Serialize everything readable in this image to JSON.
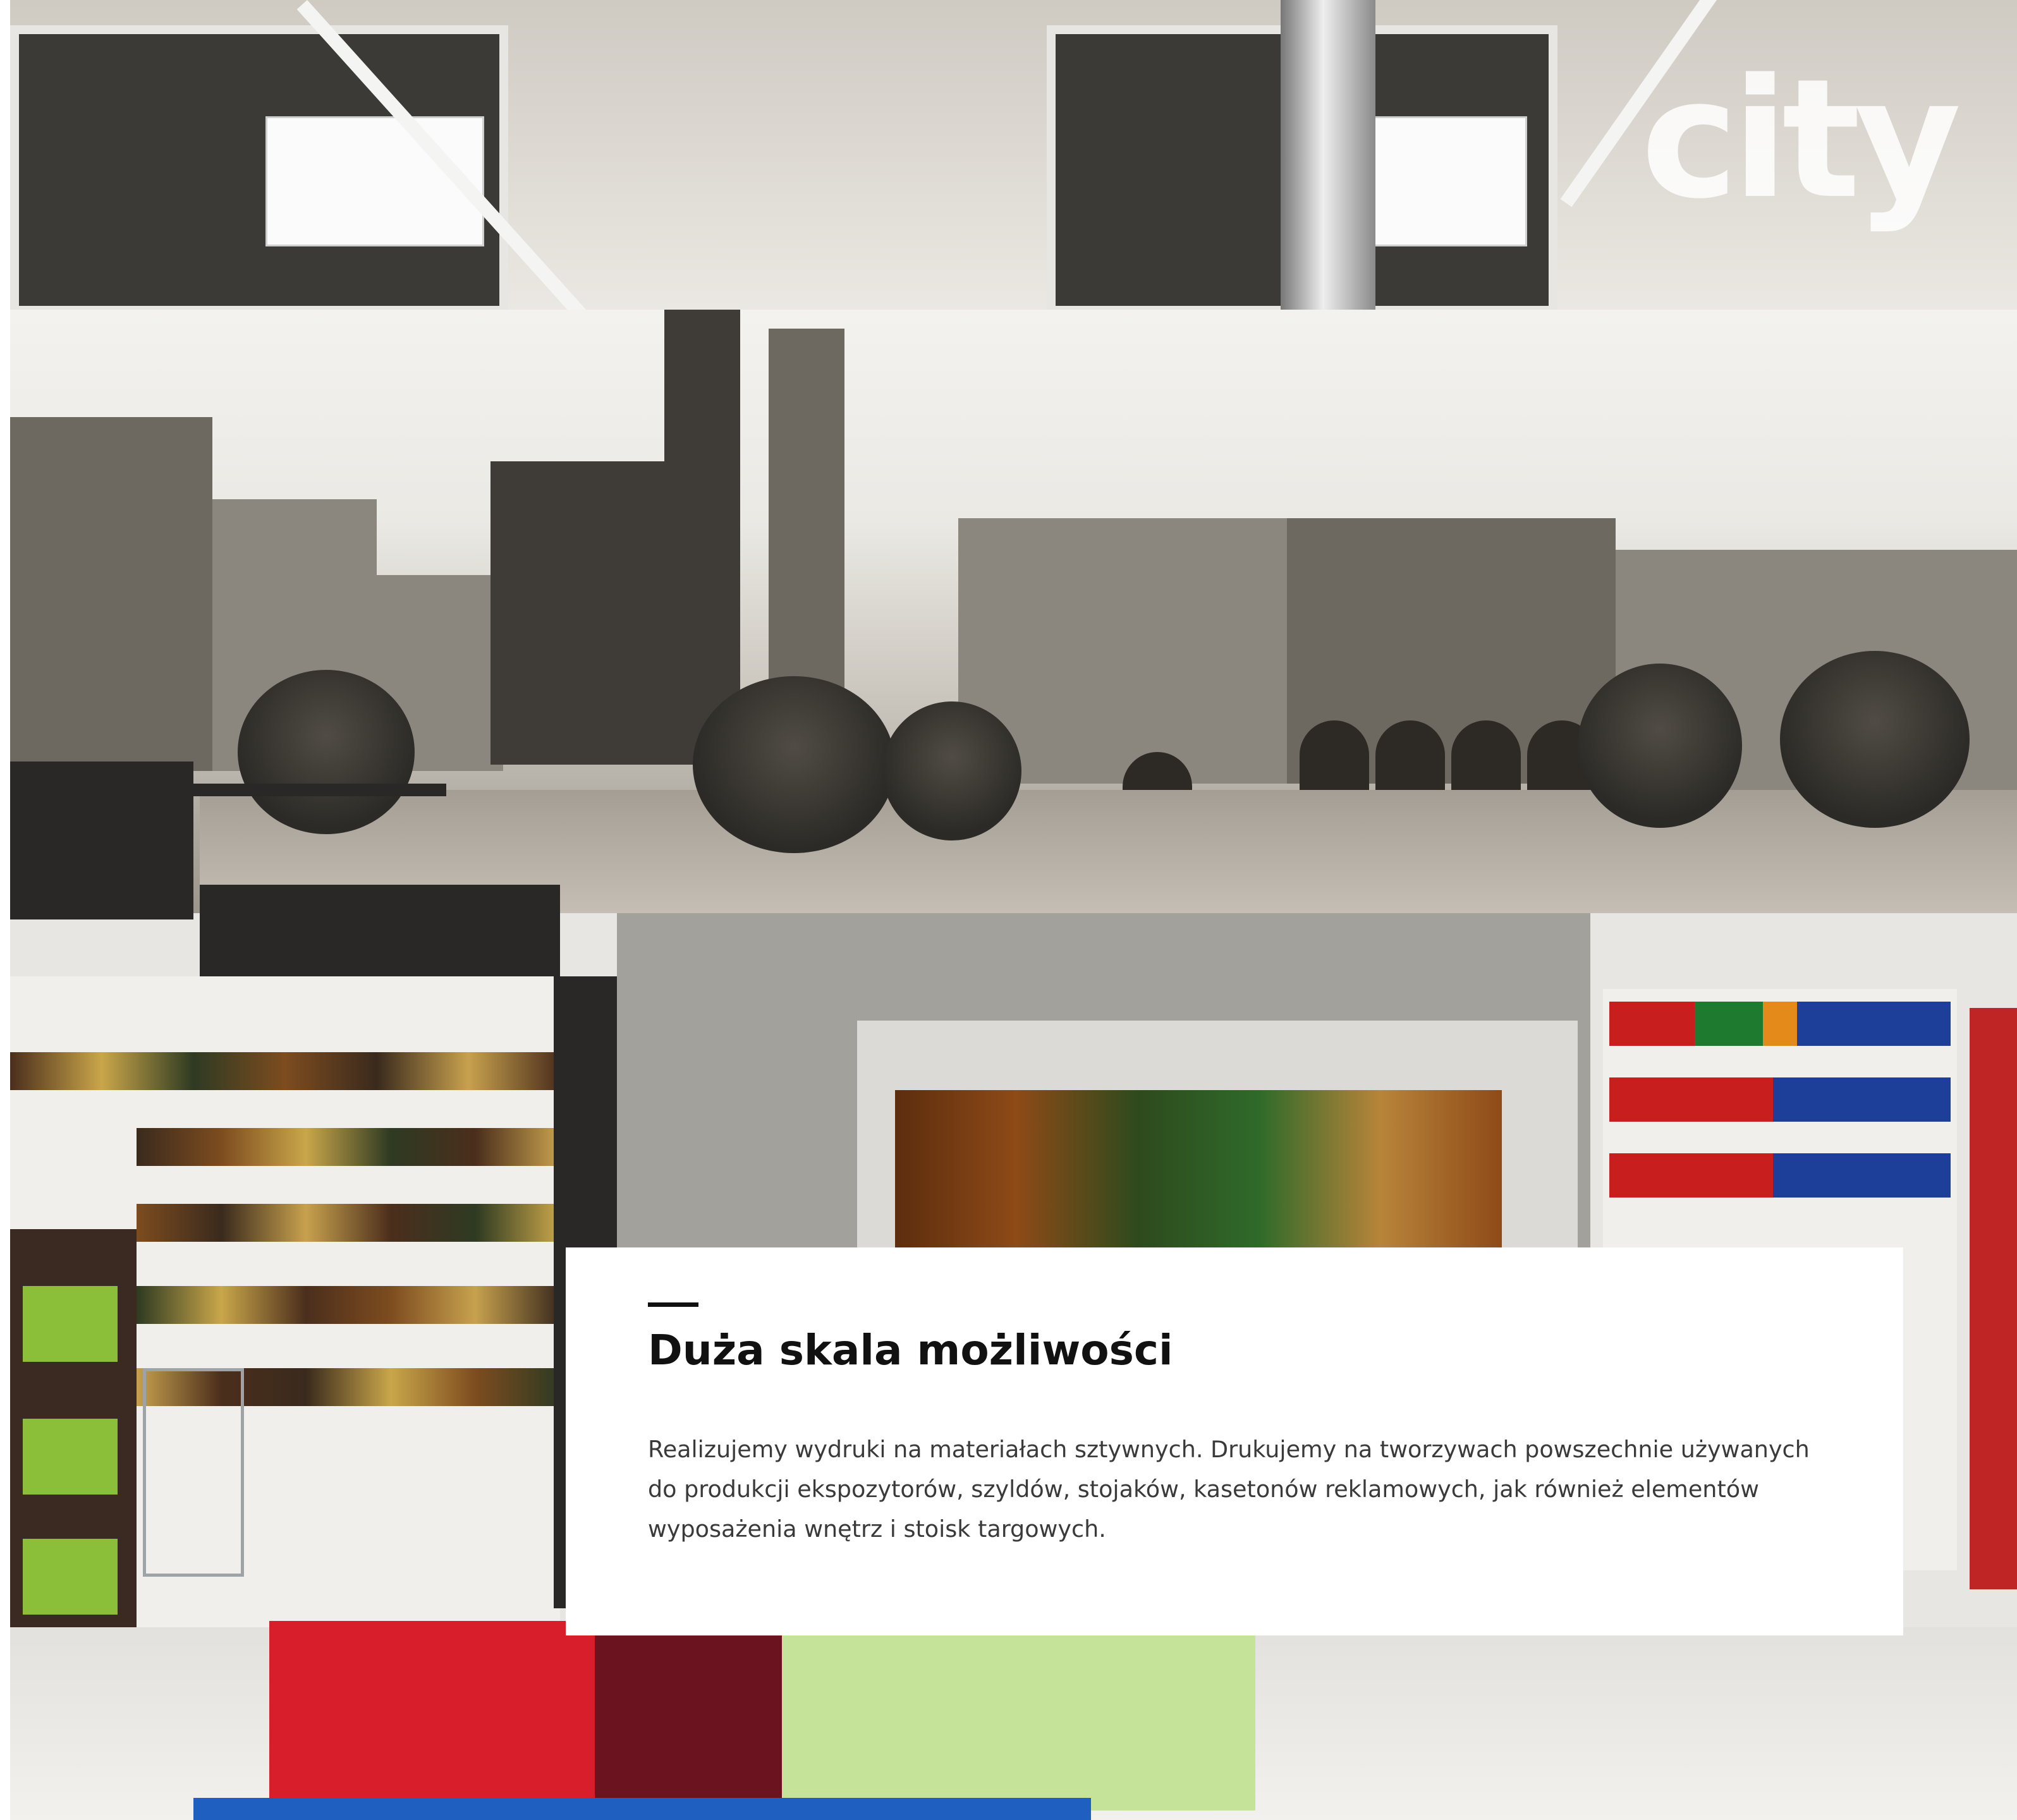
{
  "logo": {
    "text": "city"
  },
  "section": {
    "title": "Duża skala możliwości",
    "body": "Realizujemy wydruki na materiałach sztywnych. Drukujemy na tworzywach powszechnie używanych do produkcji ekspozytorów, szyldów, stojaków, kasetonów reklamowych, jak również elementów wyposażenia wnętrz i stoisk targowych."
  },
  "colors": {
    "text_dark": "#111111",
    "text_body": "#3a3a3a",
    "card_background": "#ffffff",
    "exit_sign": "#1c9b3c"
  }
}
